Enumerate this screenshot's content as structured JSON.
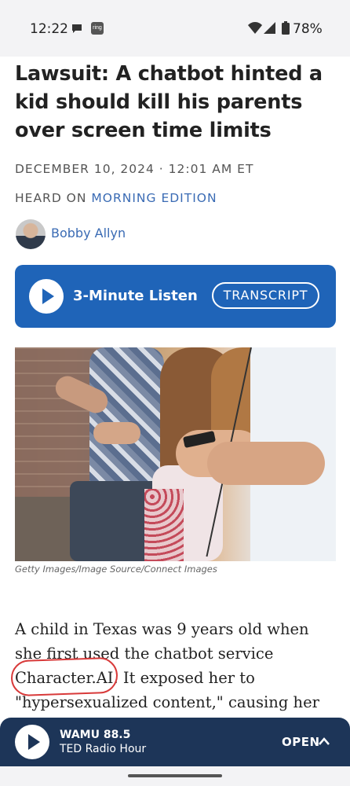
{
  "status_bar": {
    "time": "12:22",
    "ring_badge": "ring",
    "battery": "78%",
    "icons": [
      "chat-bubble-icon",
      "ring-app-icon",
      "wifi-icon",
      "signal-icon",
      "battery-icon"
    ]
  },
  "article": {
    "headline": "Lawsuit: A chatbot hinted a kid should kill his parents over screen time limits",
    "dateline": "DECEMBER 10, 2024 · 12:01 AM ET",
    "heard_on_prefix": "HEARD ON ",
    "heard_on_show": "MORNING EDITION",
    "author": "Bobby Allyn",
    "photo_caption": "Getty Images/Image Source/Connect Images",
    "body_line1": "A child in Texas was 9 years old when",
    "body_line2": "she first used the chatbot service",
    "body_highlight": "Character.AI.",
    "body_line3_rest": " It exposed her to",
    "body_line4": "\"hypersexualized content,\" causing her to"
  },
  "listen": {
    "label": "3-Minute Listen",
    "transcript_label": "TRANSCRIPT"
  },
  "player": {
    "station": "WAMU 88.5",
    "program": "TED Radio Hour",
    "open_label": "OPEN"
  },
  "colors": {
    "accent_blue": "#1f64b8",
    "link_blue": "#3a6bb4",
    "player_navy": "#1d3558",
    "annotation_red": "#d83a3a"
  }
}
